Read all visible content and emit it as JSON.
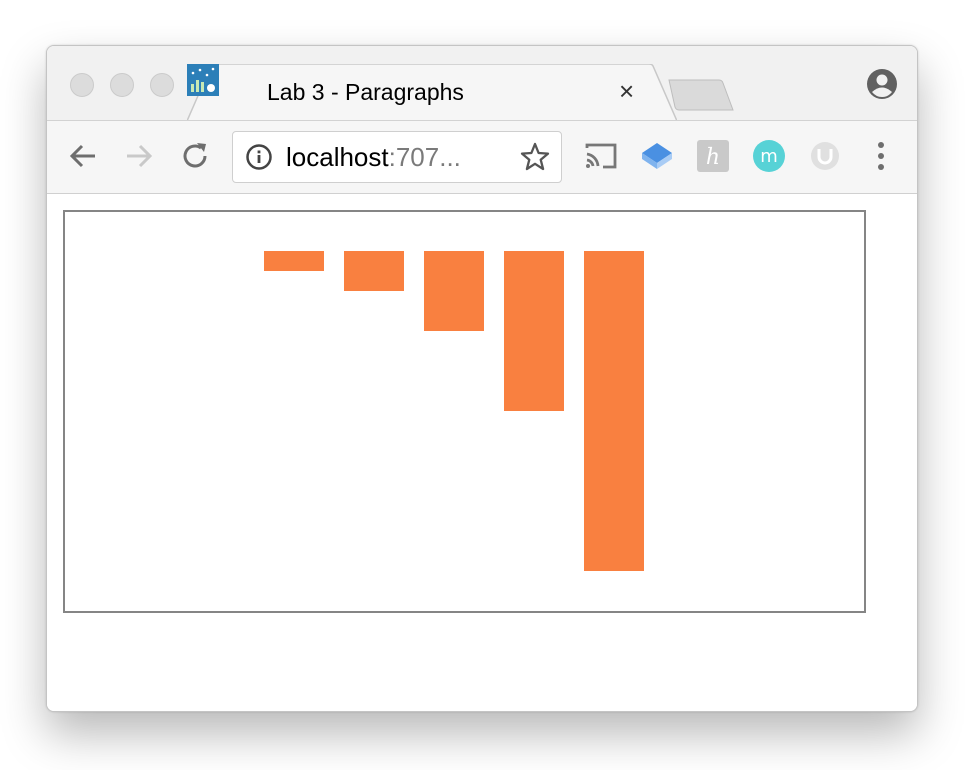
{
  "tab": {
    "title": "Lab 3 - Paragraphs",
    "close_glyph": "×"
  },
  "omnibox": {
    "host": "localhost",
    "port_truncated": ":707..."
  },
  "icons": {
    "back": "arrow-left-icon",
    "forward": "arrow-right-icon",
    "reload": "reload-icon",
    "info": "info-icon",
    "star": "star-icon",
    "cast": "cast-icon",
    "extensions": [
      "diamond-extension-icon",
      "h-extension-icon",
      "m-extension-icon",
      "u-extension-icon"
    ],
    "menu": "three-dot-menu-icon",
    "profile": "profile-icon"
  },
  "colors": {
    "bar": "#f98040",
    "frame": "#858585"
  },
  "chart_data": {
    "type": "bar",
    "orientation": "downward-from-top",
    "values": [
      1,
      2,
      4,
      8,
      16
    ],
    "axes": "none",
    "grid": false,
    "legend": "none"
  }
}
